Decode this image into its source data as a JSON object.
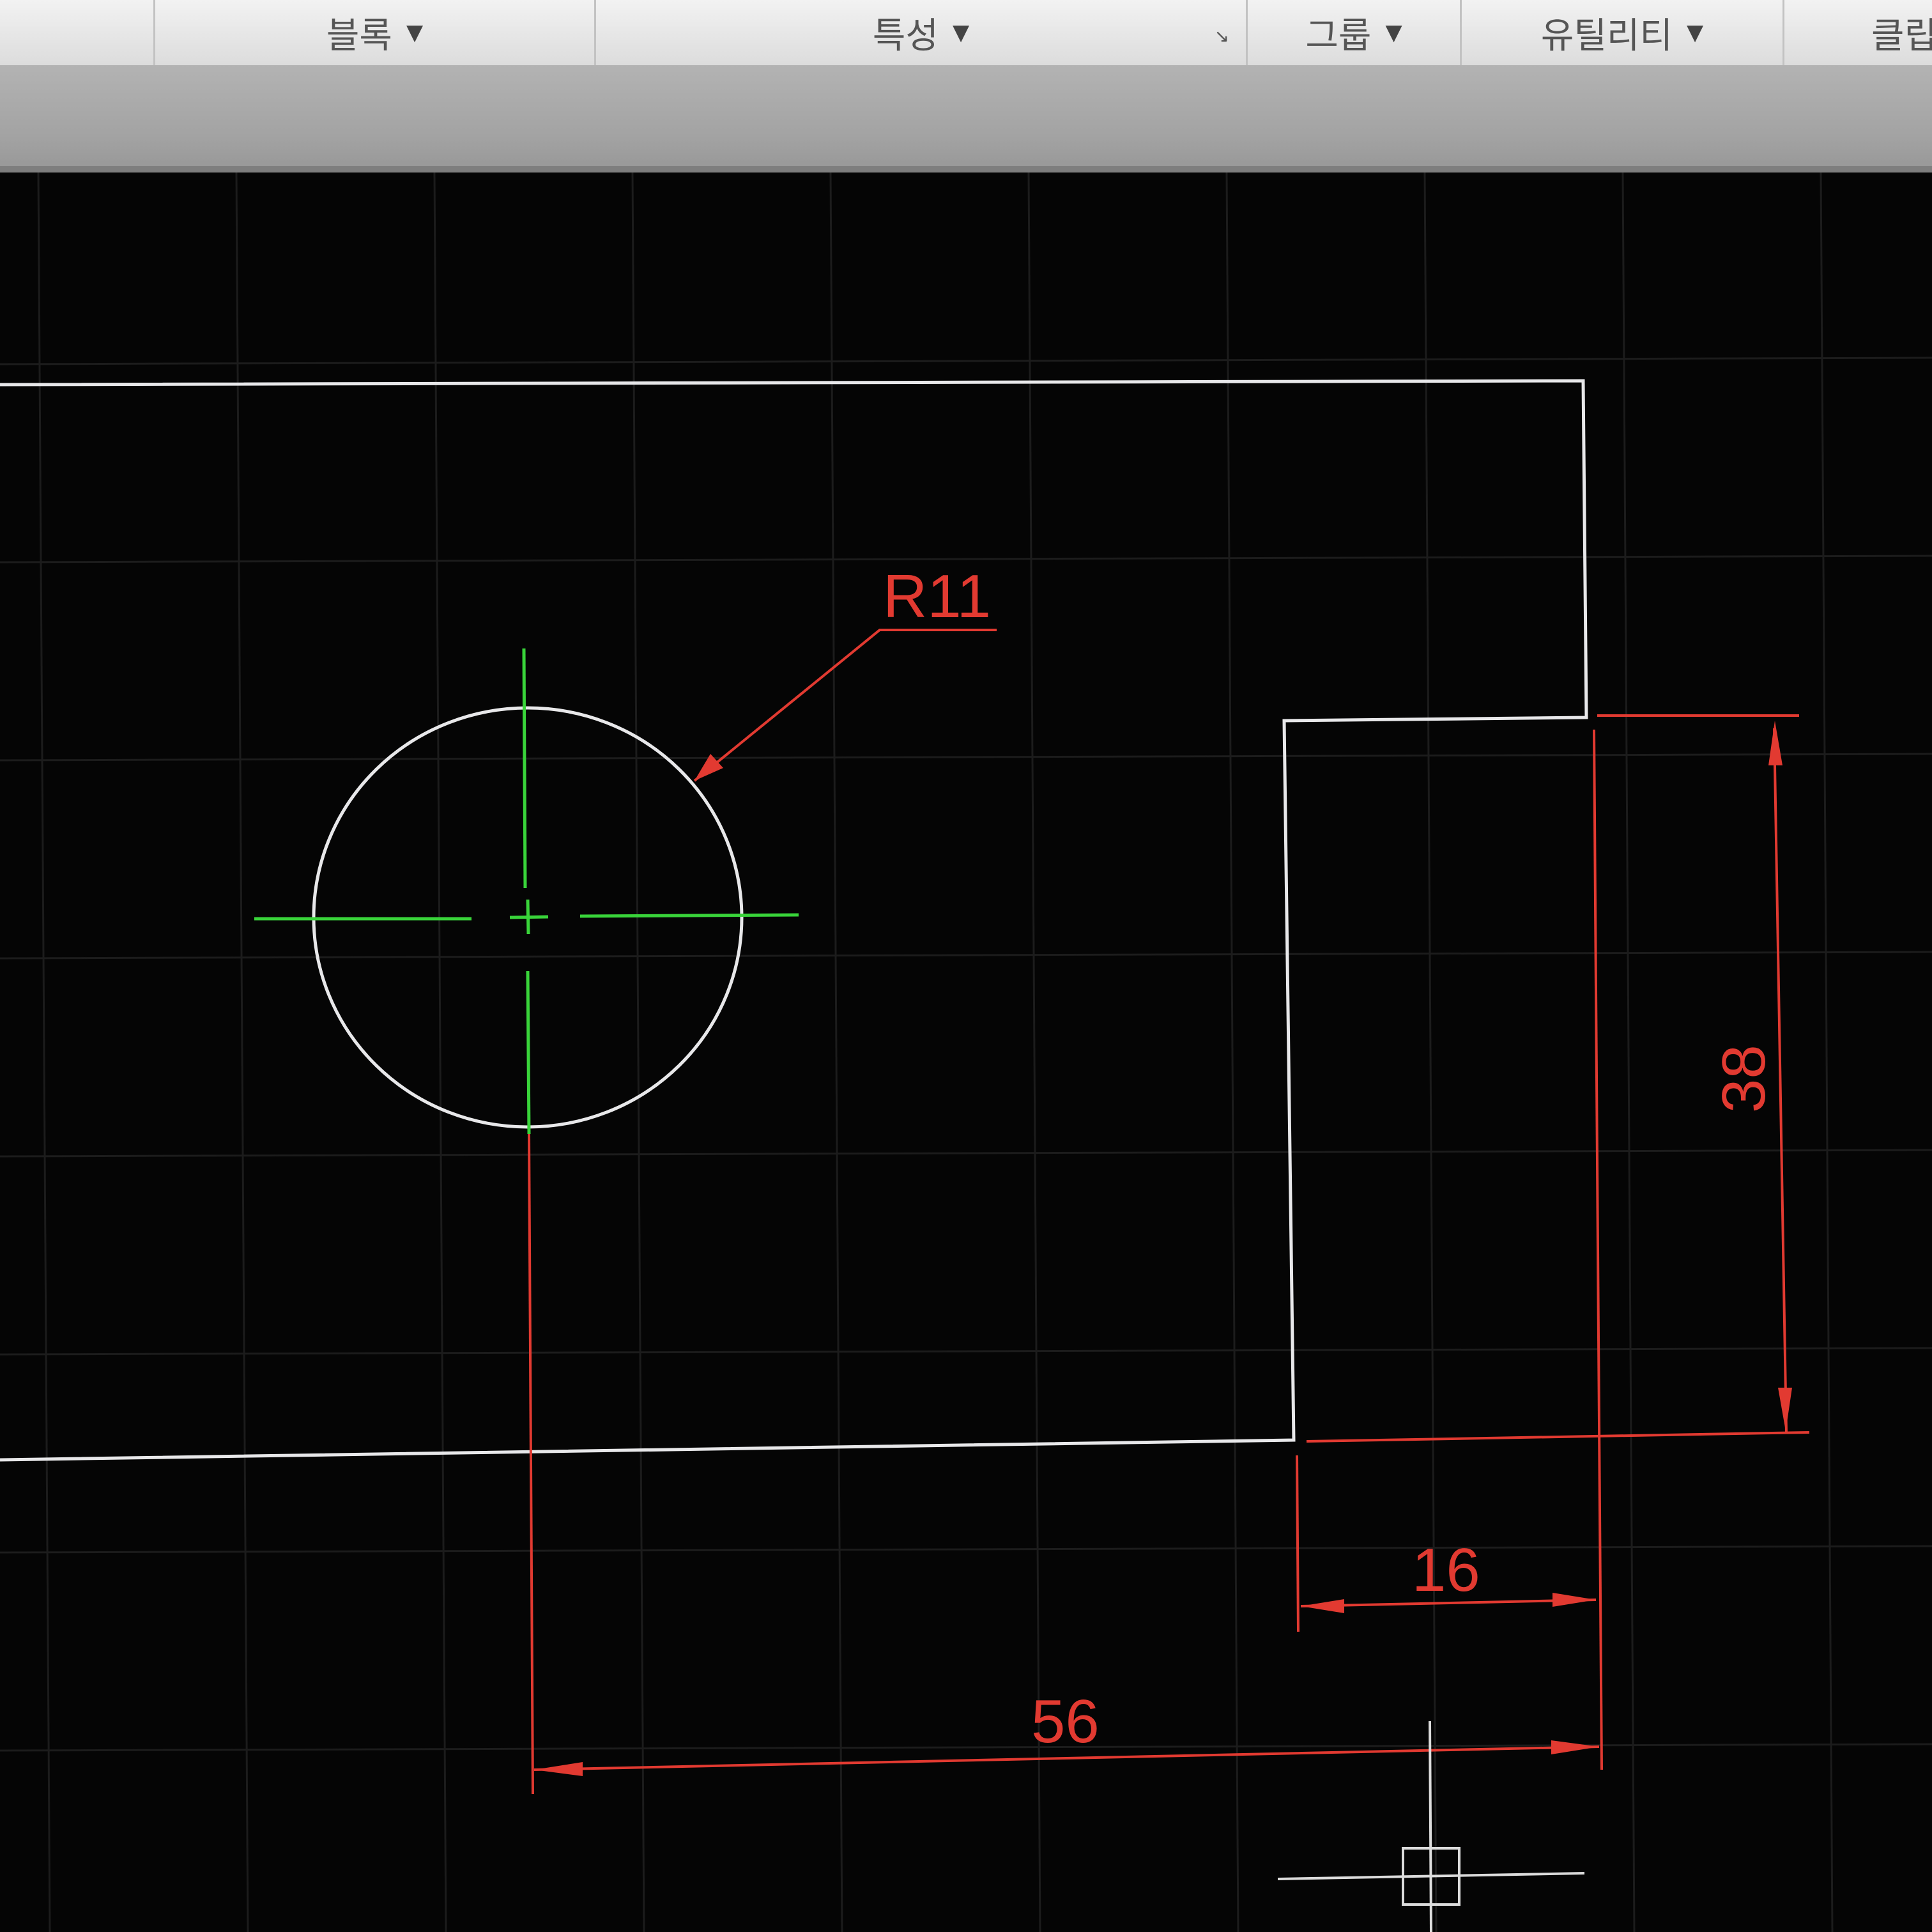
{
  "ribbon": {
    "panels": [
      {
        "label": "블록",
        "has_dropdown": true
      },
      {
        "label": "특성",
        "has_dropdown": true,
        "has_launcher": true
      },
      {
        "label": "그룹",
        "has_dropdown": true
      },
      {
        "label": "유틸리티",
        "has_dropdown": true
      },
      {
        "label": "클립",
        "has_dropdown": false
      }
    ],
    "launcher_icon": "dialog-launcher-icon"
  },
  "drawing": {
    "background_color": "#050505",
    "grid_color": "#1c1c1c",
    "object_color": "#e8e8ea",
    "centerline_color": "#39d43a",
    "dimension_color": "#e23a31",
    "dimensions": {
      "radius_label": "R11",
      "height_label": "38",
      "width_small_label": "16",
      "width_large_label": "56"
    },
    "cursor_icon": "crosshair-pickbox-icon"
  }
}
